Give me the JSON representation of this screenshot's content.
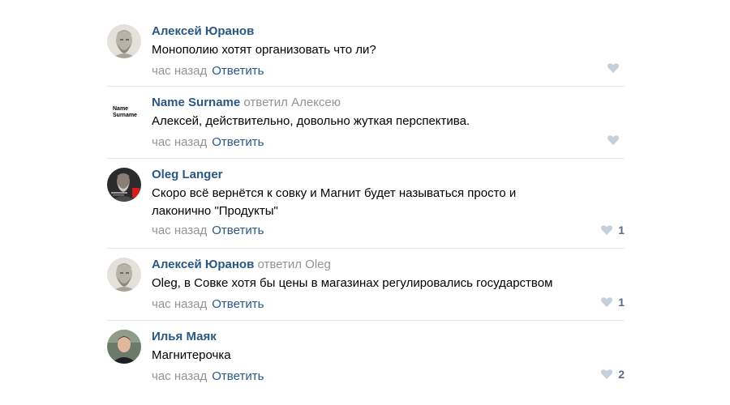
{
  "comments": [
    {
      "author": "Алексей Юранов",
      "replied_to": "",
      "text": "Монополию хотят организовать что ли?",
      "time": "час назад",
      "reply_label": "Ответить",
      "likes": "",
      "avatar": "plato-bust-avatar"
    },
    {
      "author": "Name Surname",
      "replied_to": "ответил Алексею",
      "text": "Алексей, действительно, довольно жуткая перспектива.",
      "time": "час назад",
      "reply_label": "Ответить",
      "likes": "",
      "avatar": "text-avatar",
      "avatar_text_1": "Name",
      "avatar_text_2": "Surname"
    },
    {
      "author": "Oleg Langer",
      "replied_to": "",
      "text": "Скоро всё вернётся к совку и Магнит будет называться просто и лаконично \"Продукты\"",
      "time": "час назад",
      "reply_label": "Ответить",
      "likes": "1",
      "avatar": "photo-avatar"
    },
    {
      "author": "Алексей Юранов",
      "replied_to": "ответил Oleg",
      "text": "Oleg, в Совке хотя бы цены в магазинах регулировались государством",
      "time": "час назад",
      "reply_label": "Ответить",
      "likes": "1",
      "avatar": "plato-bust-avatar"
    },
    {
      "author": "Илья Маяк",
      "replied_to": "",
      "text": "Магнитерочка",
      "time": "час назад",
      "reply_label": "Ответить",
      "likes": "2",
      "avatar": "person-photo-avatar"
    }
  ],
  "colors": {
    "link": "#2a5885",
    "muted": "#939393",
    "heart": "#c5d0db",
    "like_count": "#5b6a80",
    "divider": "#e7e8ec"
  }
}
